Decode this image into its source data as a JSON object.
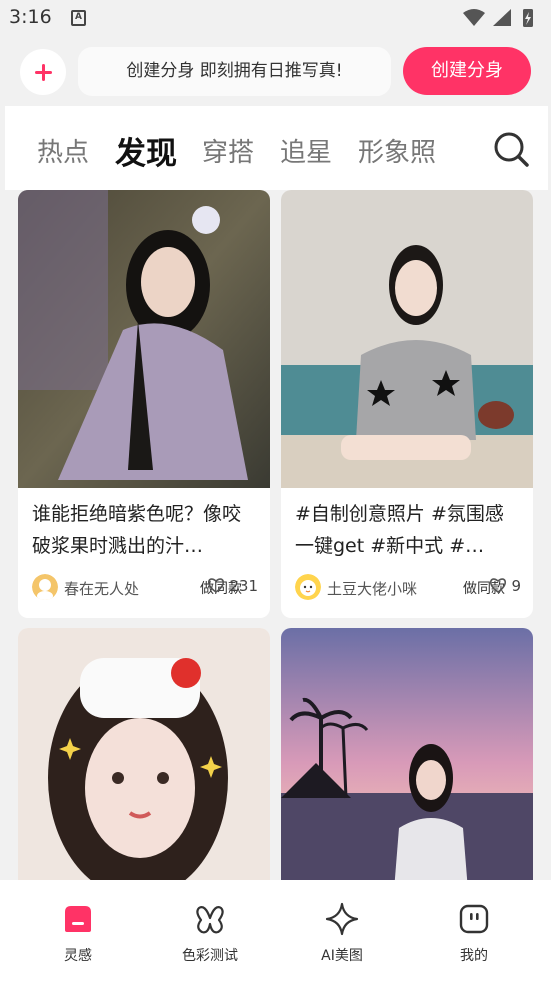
{
  "status_bar": {
    "time": "3:16",
    "sim_label": "A"
  },
  "top_bar": {
    "promo_text": "创建分身 即刻拥有日推写真!",
    "create_button": "创建分身"
  },
  "tabs": [
    "热点",
    "发现",
    "穿搭",
    "追星",
    "形象照"
  ],
  "active_tab": "发现",
  "feed": {
    "cards": [
      {
        "button": "做同款",
        "description": "谁能拒绝暗紫色呢？像咬破浆果时溅出的汁…",
        "user": "春在无人处",
        "likes": "231"
      },
      {
        "button": "做同款",
        "description": "#自制创意照片 #氛围感一键get #新中式 #…",
        "user": "土豆大佬小咪",
        "likes": "9"
      }
    ]
  },
  "bottom_nav": [
    {
      "label": "灵感",
      "icon": "inspiration-icon",
      "active": true
    },
    {
      "label": "色彩测试",
      "icon": "butterfly-icon",
      "active": false
    },
    {
      "label": "AI美图",
      "icon": "sparkle-icon",
      "active": false
    },
    {
      "label": "我的",
      "icon": "profile-icon",
      "active": false
    }
  ],
  "colors": {
    "accent": "#ff3366",
    "background": "#f1f1f1"
  }
}
